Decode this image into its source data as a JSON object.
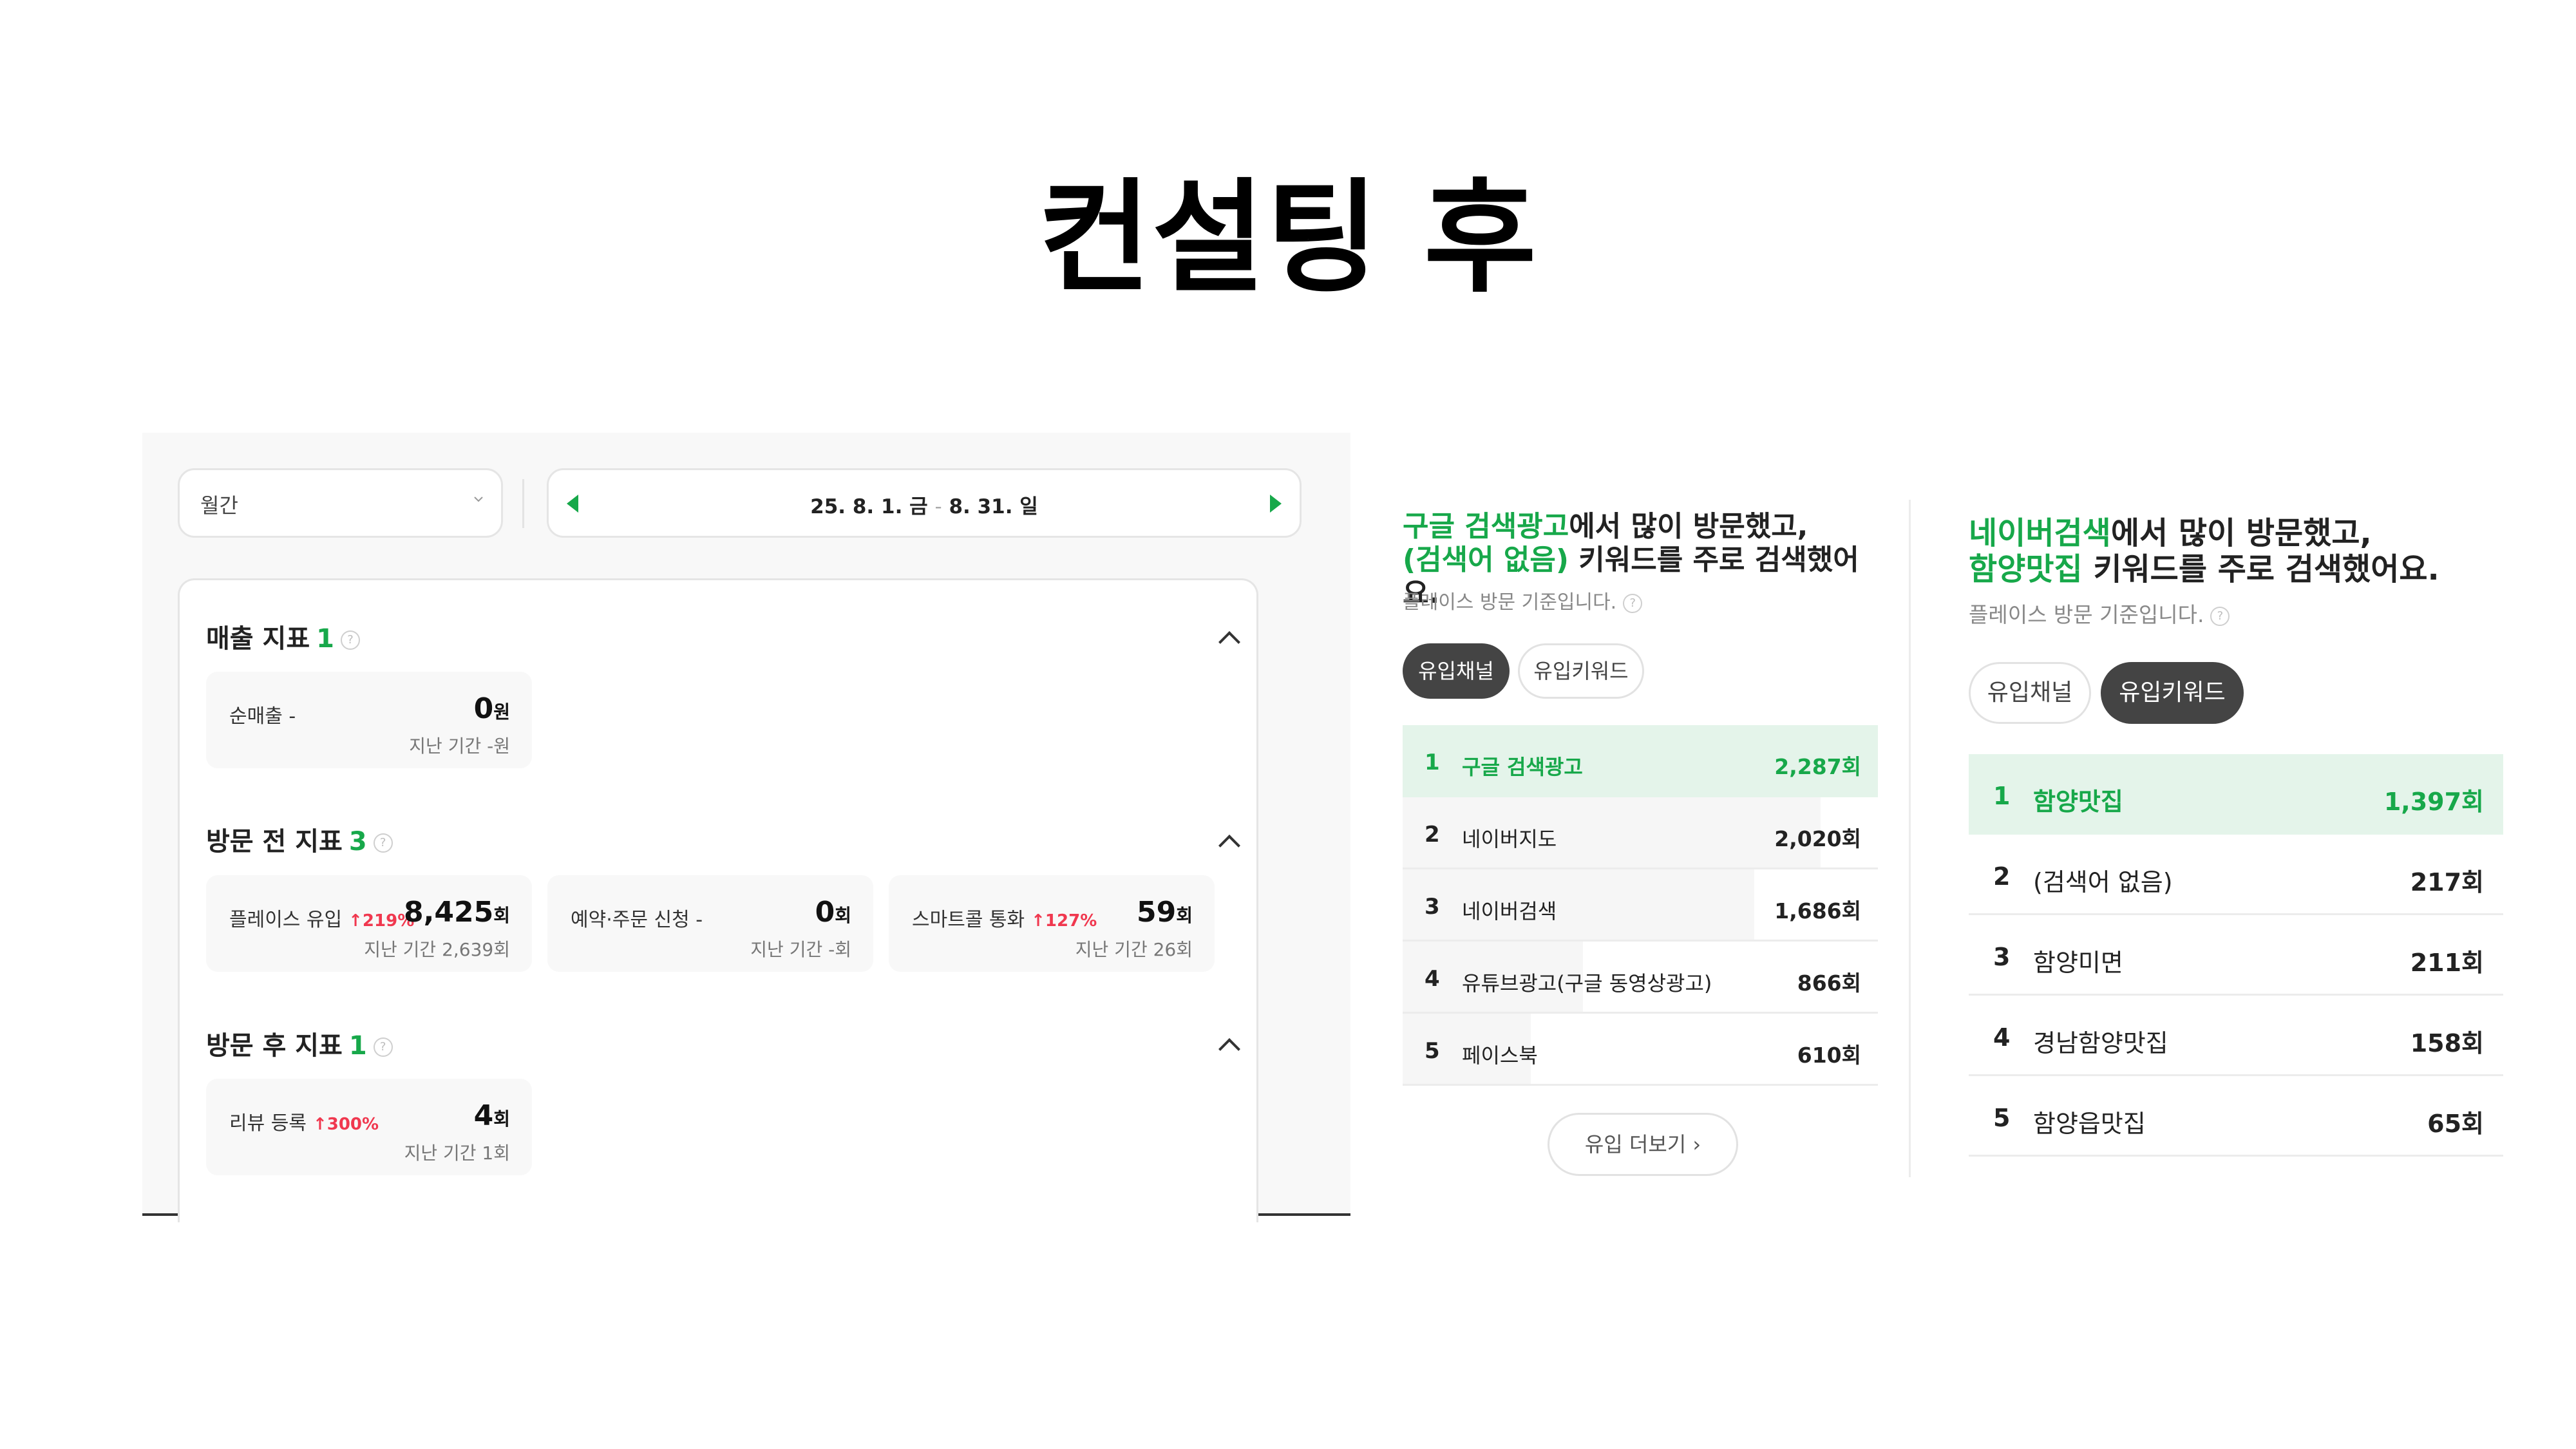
{
  "title": "컨설팅 후",
  "left": {
    "period": "월간",
    "date_start": "25. 8. 1. 금",
    "date_sep": "-",
    "date_end": "8. 31. 일",
    "sections": [
      {
        "title": "매출 지표",
        "count": "1",
        "metrics": [
          {
            "label": "순매출 -",
            "change": "",
            "value": "0",
            "unit": "원",
            "previous": "지난 기간 -원"
          }
        ]
      },
      {
        "title": "방문 전 지표",
        "count": "3",
        "metrics": [
          {
            "label": "플레이스 유입",
            "change": "↑219%",
            "value": "8,425",
            "unit": "회",
            "previous": "지난 기간 2,639회"
          },
          {
            "label": "예약·주문 신청 -",
            "change": "",
            "value": "0",
            "unit": "회",
            "previous": "지난 기간 -회"
          },
          {
            "label": "스마트콜 통화",
            "change": "↑127%",
            "value": "59",
            "unit": "회",
            "previous": "지난 기간 26회"
          }
        ]
      },
      {
        "title": "방문 후 지표",
        "count": "1",
        "metrics": [
          {
            "label": "리뷰 등록",
            "change": "↑300%",
            "value": "4",
            "unit": "회",
            "previous": "지난 기간 1회"
          }
        ]
      }
    ]
  },
  "middle": {
    "heading_highlight_1": "구글 검색광고",
    "heading_text_1": "에서 많이 방문했고,",
    "heading_highlight_2": "(검색어 없음)",
    "heading_text_2": " 키워드를 주로 검색했어요.",
    "note": "플레이스 방문 기준입니다.",
    "tabs": [
      "유입채널",
      "유입키워드"
    ],
    "active_tab": "유입채널",
    "rows": [
      {
        "rank": "1",
        "name": "구글 검색광고",
        "value": "2,287회",
        "share": 1.0
      },
      {
        "rank": "2",
        "name": "네이버지도",
        "value": "2,020회",
        "share": 0.88
      },
      {
        "rank": "3",
        "name": "네이버검색",
        "value": "1,686회",
        "share": 0.74
      },
      {
        "rank": "4",
        "name": "유튜브광고(구글 동영상광고)",
        "value": "866회",
        "share": 0.38
      },
      {
        "rank": "5",
        "name": "페이스북",
        "value": "610회",
        "share": 0.27
      }
    ],
    "more_label": "유입 더보기 ›"
  },
  "right": {
    "heading_highlight_1": "네이버검색",
    "heading_text_1": "에서 많이 방문했고,",
    "heading_highlight_2": "함양맛집",
    "heading_text_2": " 키워드를 주로 검색했어요.",
    "note": "플레이스 방문 기준입니다.",
    "tabs": [
      "유입채널",
      "유입키워드"
    ],
    "active_tab": "유입키워드",
    "rows": [
      {
        "rank": "1",
        "name": "함양맛집",
        "value": "1,397회"
      },
      {
        "rank": "2",
        "name": "(검색어 없음)",
        "value": "217회"
      },
      {
        "rank": "3",
        "name": "함양미면",
        "value": "211회"
      },
      {
        "rank": "4",
        "name": "경남함양맛집",
        "value": "158회"
      },
      {
        "rank": "5",
        "name": "함양읍맛집",
        "value": "65회"
      }
    ]
  },
  "icons": {
    "help": "question-circle-icon",
    "collapse": "chevron-up-icon",
    "dropdown": "chevron-down-icon"
  },
  "colors": {
    "accent": "#17a84a",
    "increase": "#f0384f",
    "highlight_row": "#e4f4ea",
    "active_tab": "#444444"
  }
}
